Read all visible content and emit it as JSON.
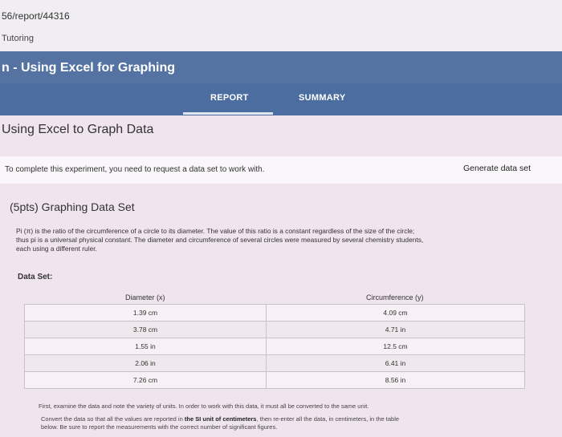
{
  "browser": {
    "url": "56/report/44316",
    "subtitle": "Tutoring"
  },
  "banner": {
    "title": "n - Using Excel for Graphing"
  },
  "tabs": [
    {
      "label": "REPORT",
      "active": true
    },
    {
      "label": "SUMMARY",
      "active": false
    }
  ],
  "main": {
    "heading": "Using Excel to Graph Data",
    "request_text": "To complete this experiment, you need to request a data set to work with.",
    "generate_button": "Generate data set",
    "section_title": "(5pts) Graphing Data Set",
    "paragraph_line1": "Pi (π) is the ratio of the circumference of a circle to its diameter. The value of this ratio is a constant regardless of the size of the circle;",
    "paragraph_line2": "thus pi is a universal physical constant. The diameter and circumference of several circles were measured by several chemistry students,",
    "paragraph_line3": "each using a different ruler.",
    "dataset_label": "Data Set:",
    "table": {
      "headers": [
        "Diameter (x)",
        "Circumference (y)"
      ],
      "rows": [
        [
          "1.39 cm",
          "4.09 cm"
        ],
        [
          "3.78 cm",
          "4.71 in"
        ],
        [
          "1.55 in",
          "12.5 cm"
        ],
        [
          "2.06 in",
          "6.41 in"
        ],
        [
          "7.26 cm",
          "8.56 in"
        ]
      ]
    },
    "note1": "First, examine the data and note the variety of units. In order to work with this data, it must all be converted to the same unit.",
    "note2_a": "Convert the data so that all the values are reported in ",
    "note2_bold": "the SI unit of centimeters",
    "note2_b": ", then re-enter all the data, in centimeters, in the table",
    "note2_c": "below. Be sure to report the measurements with the correct number of significant figures."
  }
}
